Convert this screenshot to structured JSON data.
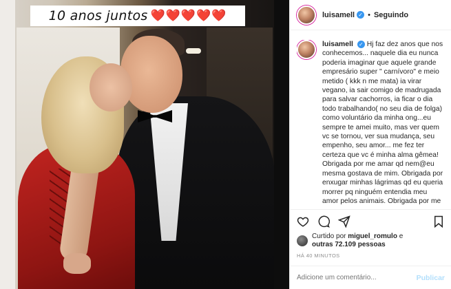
{
  "photo": {
    "caption": "10 anos juntos",
    "hearts": "❤️❤️❤️❤️❤️"
  },
  "header": {
    "username": "luisamell",
    "separator": "•",
    "follow_state": "Seguindo"
  },
  "comment": {
    "username": "luisamell",
    "text": "Hj faz dez anos que nos conhecemos... naquele dia eu nunca poderia imaginar que aquele grande empresário super \" carnívoro\" e meio metido ( kkk n me mata) ia virar vegano, ia sair comigo de madrugada para salvar cachorros, ia ficar o dia todo trabalhando( no seu dia de folga) como voluntário da minha ong...eu sempre te amei muito, mas ver quem vc se tornou, ver sua mudança, seu empenho, seu amor... me fez ter certeza que vc é minha alma gêmea! Obrigada por me amar qd nem@eu mesma gostava de mim. Obrigada por enxugar minhas lágrimas qd eu queria morrer pq ninguém entendia meu amor pelos animais. Obrigada por me dar apoio para eu tentar mudar o"
  },
  "actions": {
    "icons": [
      "heart-icon",
      "comment-icon",
      "share-icon",
      "bookmark-icon"
    ]
  },
  "likes": {
    "prefix": "Curtido por ",
    "user": "miguel_romulo",
    "middle": " e",
    "others": "outras 72.109 pessoas"
  },
  "time": "HÁ 40 MINUTOS",
  "add_comment": {
    "placeholder": "Adicione um comentário...",
    "publish_label": "Publicar"
  },
  "colors": {
    "verified": "#3897f0",
    "publish_disabled": "#b2dffc",
    "border": "#efefef",
    "muted": "#8e8e8e"
  }
}
